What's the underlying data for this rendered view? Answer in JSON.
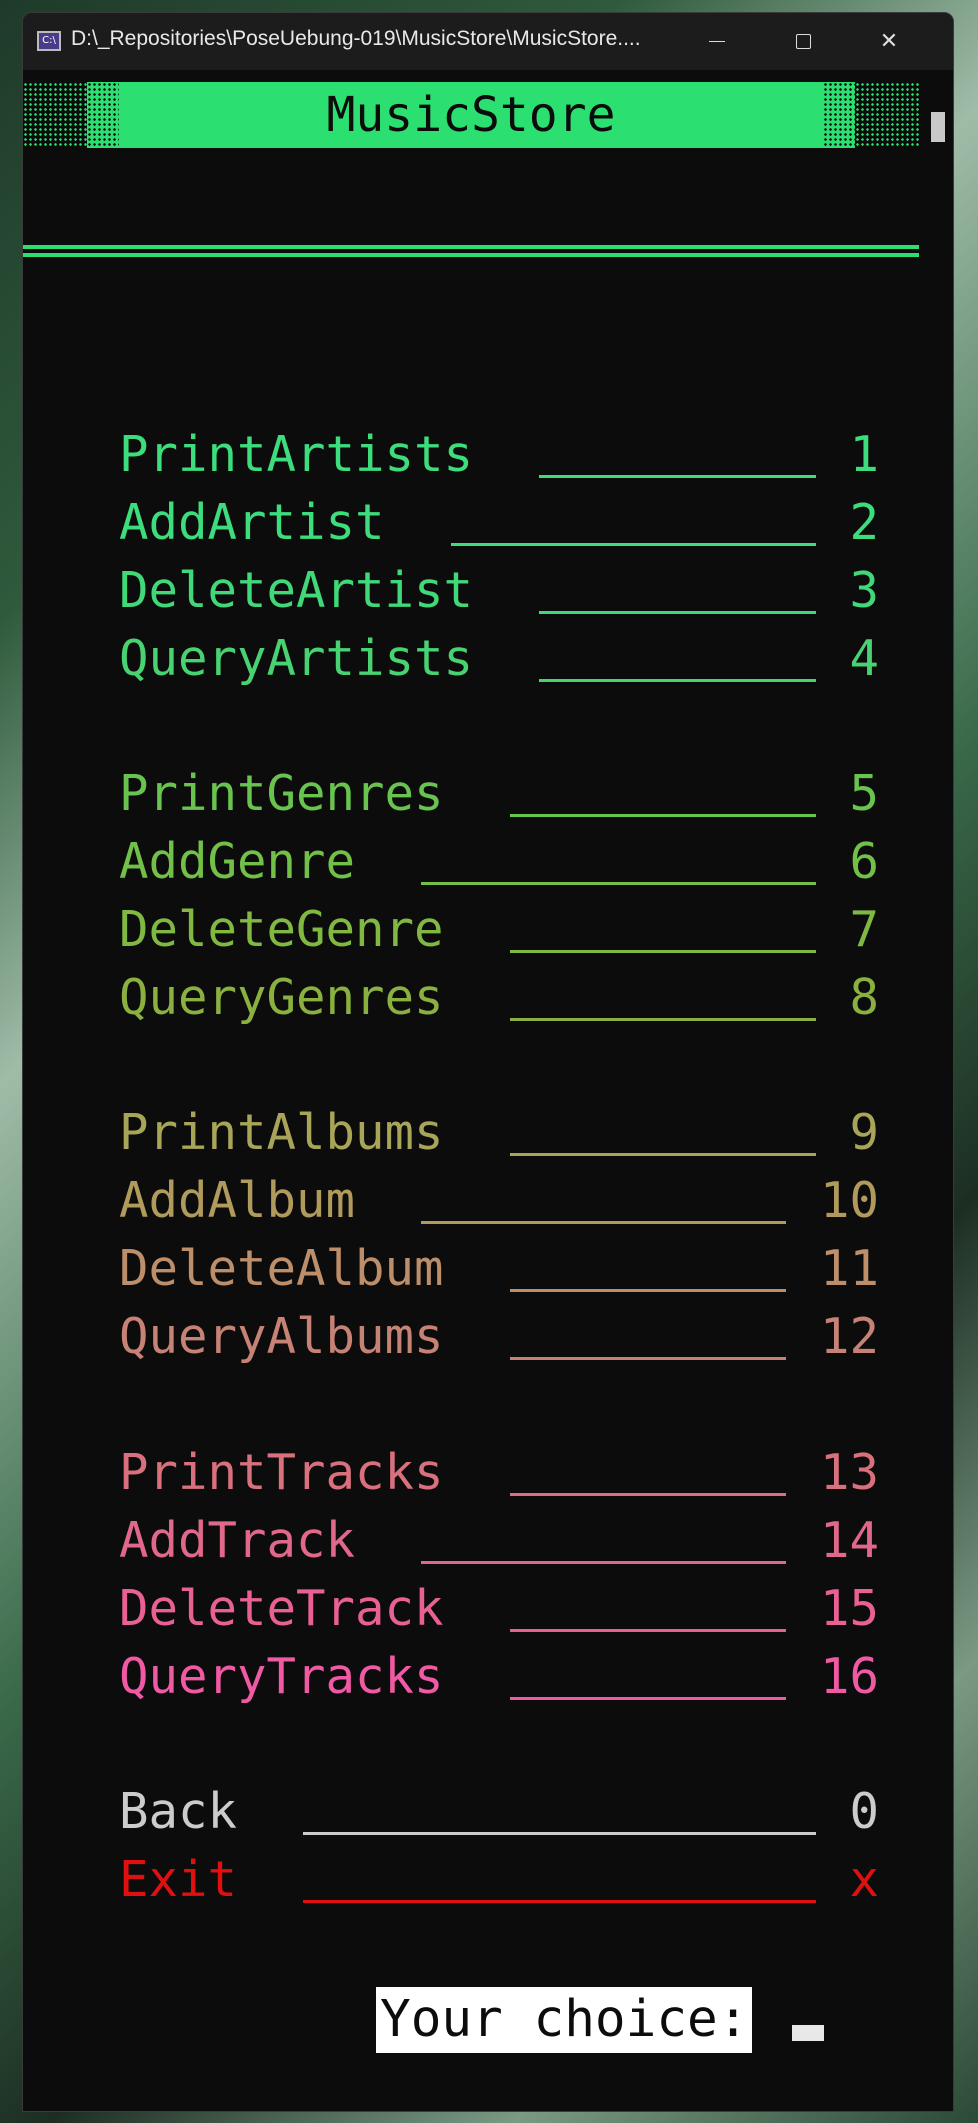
{
  "window": {
    "title": "D:\\_Repositories\\PoseUebung-019\\MusicStore\\MusicStore....",
    "icon": "cmd-icon",
    "minimize_glyph": "minimize-icon",
    "maximize_glyph": "maximize-icon",
    "close_glyph": "✕"
  },
  "banner": {
    "title": "MusicStore",
    "color": "#2be070"
  },
  "menu": {
    "items": [
      {
        "label": "PrintArtists",
        "key": "1",
        "color": "#3ddc7c"
      },
      {
        "label": "AddArtist",
        "key": "2",
        "color": "#3ddc7c"
      },
      {
        "label": "DeleteArtist",
        "key": "3",
        "color": "#40d878"
      },
      {
        "label": "QueryArtists",
        "key": "4",
        "color": "#48d272"
      },
      {
        "label": "PrintGenres",
        "key": "5",
        "color": "#68c44e"
      },
      {
        "label": "AddGenre",
        "key": "6",
        "color": "#72c048"
      },
      {
        "label": "DeleteGenre",
        "key": "7",
        "color": "#80b842"
      },
      {
        "label": "QueryGenres",
        "key": "8",
        "color": "#8ab040"
      },
      {
        "label": "PrintAlbums",
        "key": "9",
        "color": "#a8a458"
      },
      {
        "label": "AddAlbum",
        "key": "10",
        "color": "#b09a5c"
      },
      {
        "label": "DeleteAlbum",
        "key": "11",
        "color": "#bc8e6a"
      },
      {
        "label": "QueryAlbums",
        "key": "12",
        "color": "#c68274"
      },
      {
        "label": "PrintTracks",
        "key": "13",
        "color": "#d8707e"
      },
      {
        "label": "AddTrack",
        "key": "14",
        "color": "#e0688a"
      },
      {
        "label": "DeleteTrack",
        "key": "15",
        "color": "#e86094"
      },
      {
        "label": "QueryTracks",
        "key": "16",
        "color": "#f05aa4"
      },
      {
        "label": "Back",
        "key": "0",
        "color": "#cccccc"
      },
      {
        "label": "Exit",
        "key": "x",
        "color": "#e01010"
      }
    ]
  },
  "prompt": {
    "label": "Your choice:"
  }
}
